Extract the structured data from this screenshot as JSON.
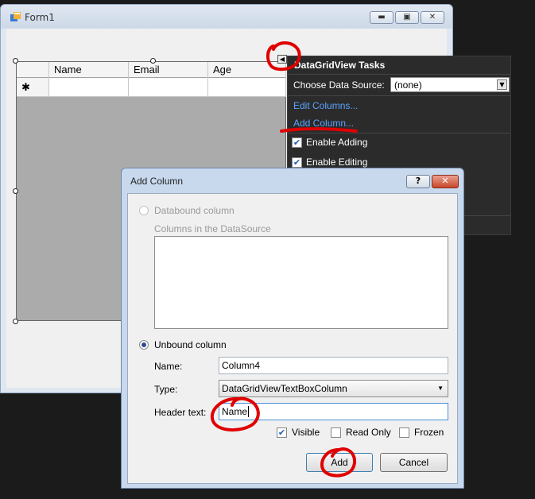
{
  "form": {
    "title": "Form1",
    "grid": {
      "columns": [
        "Name",
        "Email",
        "Age"
      ],
      "new_row_marker": "✱"
    }
  },
  "tasks_panel": {
    "title": "DataGridView Tasks",
    "data_source_label": "Choose Data Source:",
    "data_source_value": "(none)",
    "edit_columns": "Edit Columns...",
    "add_column": "Add Column...",
    "enable_adding": {
      "label": "Enable Adding",
      "checked": true
    },
    "enable_editing": {
      "label": "Enable Editing",
      "checked": true
    }
  },
  "dialog": {
    "title": "Add Column",
    "help_button": "?",
    "close_button": "✕",
    "databound_label": "Databound column",
    "columns_in_source_label": "Columns in the DataSource",
    "unbound_label": "Unbound column",
    "name_label": "Name:",
    "name_value": "Column4",
    "type_label": "Type:",
    "type_value": "DataGridViewTextBoxColumn",
    "header_text_label": "Header text:",
    "header_text_value": "Name",
    "visible": {
      "label": "Visible",
      "checked": true
    },
    "read_only": {
      "label": "Read Only",
      "checked": false
    },
    "frozen": {
      "label": "Frozen",
      "checked": false
    },
    "add_button": "Add",
    "cancel_button": "Cancel"
  },
  "colors": {
    "annotation": "#e00000",
    "link": "#5ba3ff",
    "grid_background": "#ababab"
  }
}
